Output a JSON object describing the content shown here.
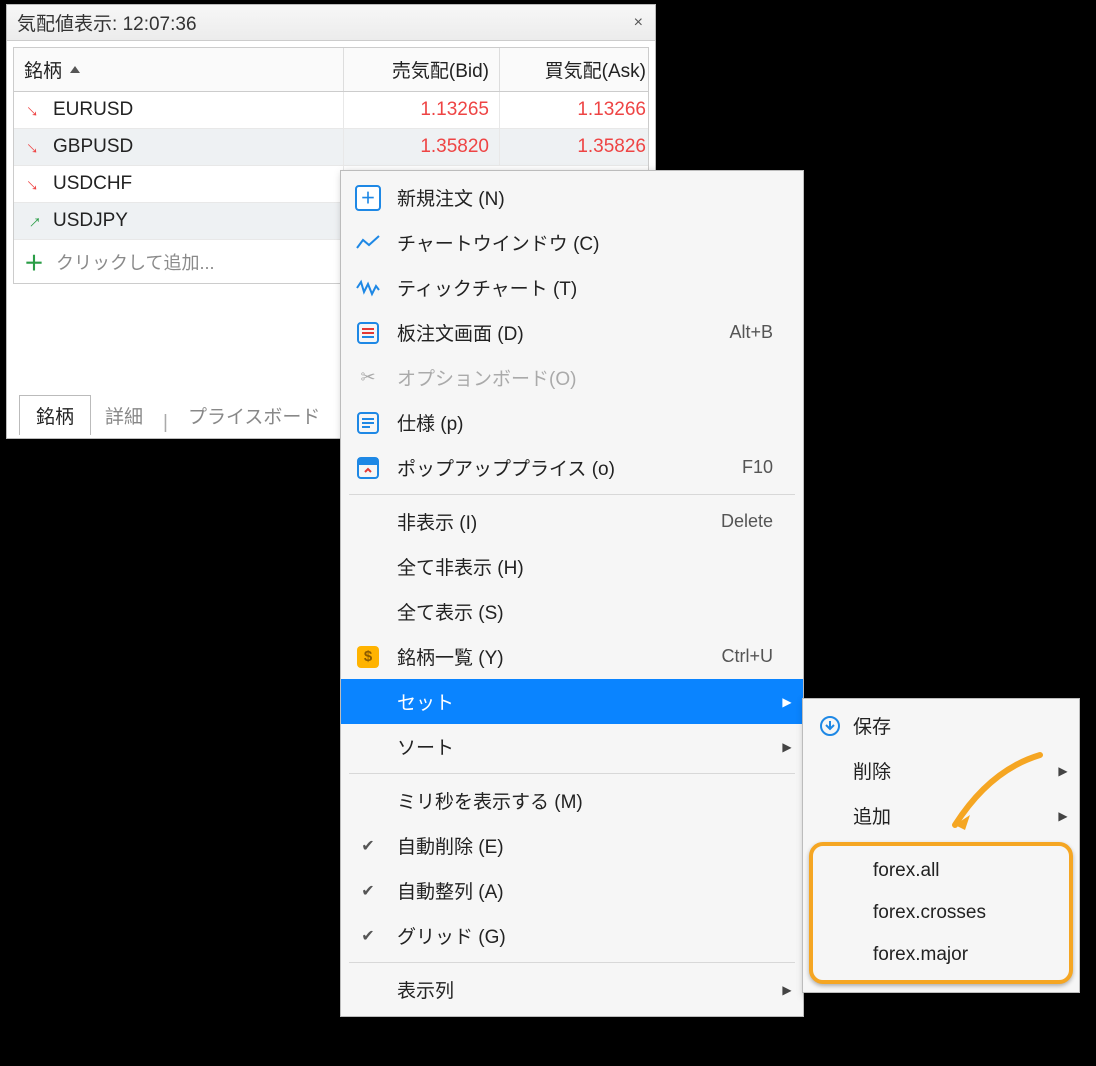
{
  "mw": {
    "title_prefix": "気配値表示:",
    "time": "12:07:36",
    "columns": {
      "symbol": "銘柄",
      "bid": "売気配(Bid)",
      "ask": "買気配(Ask)"
    },
    "rows": [
      {
        "dir": "down",
        "symbol": "EURUSD",
        "bid": "1.13265",
        "ask": "1.13266",
        "hl": false
      },
      {
        "dir": "down",
        "symbol": "GBPUSD",
        "bid": "1.35820",
        "ask": "1.35826",
        "hl": true
      },
      {
        "dir": "down",
        "symbol": "USDCHF",
        "bid": "",
        "ask": "",
        "hl": false
      },
      {
        "dir": "up",
        "symbol": "USDJPY",
        "bid": "",
        "ask": "",
        "hl": true
      }
    ],
    "add_label": "クリックして追加...",
    "tabs": {
      "symbols": "銘柄",
      "details": "詳細",
      "priceboard": "プライスボード"
    }
  },
  "menu": {
    "new_order": "新規注文 (N)",
    "chart_win": "チャートウインドウ (C)",
    "tick_chart": "ティックチャート (T)",
    "depth": "板注文画面 (D)",
    "depth_key": "Alt+B",
    "option": "オプションボード(O)",
    "spec": "仕様 (p)",
    "popup": "ポップアッププライス (o)",
    "popup_key": "F10",
    "hide": "非表示 (I)",
    "hide_key": "Delete",
    "hide_all": "全て非表示 (H)",
    "show_all": "全て表示 (S)",
    "sym_list": "銘柄一覧 (Y)",
    "sym_key": "Ctrl+U",
    "sets": "セット",
    "sort": "ソート",
    "show_ms": "ミリ秒を表示する (M)",
    "auto_del": "自動削除 (E)",
    "auto_arr": "自動整列 (A)",
    "grid": "グリッド (G)",
    "columns": "表示列"
  },
  "submenu": {
    "save": "保存",
    "delete": "削除",
    "add": "追加",
    "set_all": "forex.all",
    "set_crosses": "forex.crosses",
    "set_major": "forex.major"
  }
}
